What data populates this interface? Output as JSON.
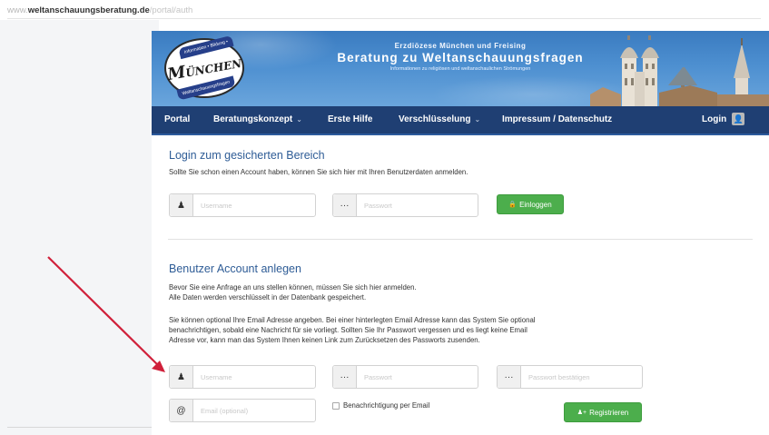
{
  "urlbar": {
    "prefix": "www.",
    "host": "weltanschauungsberatung.de",
    "path": "/portal/auth"
  },
  "banner": {
    "logo_top": "Information • Bildung • Beratung",
    "logo_word_cap": "M",
    "logo_word_rest": "ÜNCHEN",
    "logo_bottom": "Weltanschauungsfragen",
    "line1": "Erzdiözese München und Freising",
    "line2": "Beratung zu Weltanschauungsfragen",
    "line3": "Informationen zu religiösen und weltanschaulichen Strömungen"
  },
  "nav": {
    "items": [
      {
        "label": "Portal",
        "dropdown": false
      },
      {
        "label": "Beratungskonzept",
        "dropdown": true
      },
      {
        "label": "Erste Hilfe",
        "dropdown": false
      },
      {
        "label": "Verschlüsselung",
        "dropdown": true
      },
      {
        "label": "Impressum / Datenschutz",
        "dropdown": false
      }
    ],
    "login": "Login"
  },
  "login_section": {
    "title": "Login zum gesicherten Bereich",
    "text": "Sollte Sie schon einen Account haben, können Sie sich hier mit Ihren Benutzerdaten anmelden.",
    "username_placeholder": "Username",
    "password_placeholder": "Passwort",
    "button": "Einloggen"
  },
  "register_section": {
    "title": "Benutzer Account anlegen",
    "text1": "Bevor Sie eine Anfrage an uns stellen können, müssen Sie sich hier anmelden.",
    "text2": "Alle Daten werden verschlüsselt in der Datenbank gespeichert.",
    "text3": "Sie können optional Ihre Email Adresse angeben. Bei einer hinterlegten Email Adresse kann das System Sie optional",
    "text4": "benachrichtigen, sobald eine Nachricht für sie vorliegt. Sollten Sie Ihr Passwort vergessen und es liegt keine Email",
    "text5": "Adresse vor, kann man das System Ihnen keinen Link zum Zurücksetzen des Passworts zusenden.",
    "username_placeholder": "Username",
    "password_placeholder": "Passwort",
    "password_confirm_placeholder": "Passwort bestätigen",
    "email_placeholder": "Email (optional)",
    "checkbox_label": "Benachrichtigung per Email",
    "button": "Registrieren"
  },
  "colors": {
    "nav_bg": "#1f3f73",
    "heading": "#2e5c96",
    "button_green": "#4cae4c",
    "arrow": "#d0203a"
  },
  "icons": {
    "user": "user-icon",
    "password": "dots-icon",
    "email": "at-icon",
    "lock": "lock-icon",
    "user_plus": "user-plus-icon"
  }
}
